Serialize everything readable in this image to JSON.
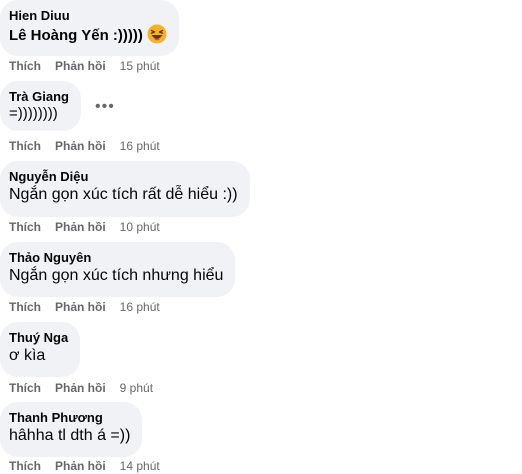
{
  "comments": [
    {
      "author": "Hien Diuu",
      "text": "Lê Hoàng Yến :)))))",
      "emoji": "laughing-emoji",
      "like_label": "Thích",
      "reply_label": "Phản hồi",
      "time": "15 phút"
    },
    {
      "author": "Trà Giang",
      "text": "=))))))))",
      "more_label": "•••",
      "like_label": "Thích",
      "reply_label": "Phản hồi",
      "time": "16 phút"
    },
    {
      "author": "Nguyễn Diệu",
      "text": "Ngắn gọn xúc tích rất dễ hiểu :))",
      "like_label": "Thích",
      "reply_label": "Phản hồi",
      "time": "10 phút"
    },
    {
      "author": "Thảo Nguyên",
      "text": "Ngắn gọn xúc tích nhưng hiểu",
      "like_label": "Thích",
      "reply_label": "Phản hồi",
      "time": "16 phút"
    },
    {
      "author": "Thuý Nga",
      "text": "ơ kìa",
      "like_label": "Thích",
      "reply_label": "Phản hồi",
      "time": "9 phút"
    },
    {
      "author": "Thanh Phương",
      "text": "hâhha tl dth á =))",
      "like_label": "Thích",
      "reply_label": "Phản hồi",
      "time": "14 phút"
    }
  ],
  "colors": {
    "bubble": "#f0f2f5",
    "text": "#050505",
    "secondary": "#65676b"
  }
}
